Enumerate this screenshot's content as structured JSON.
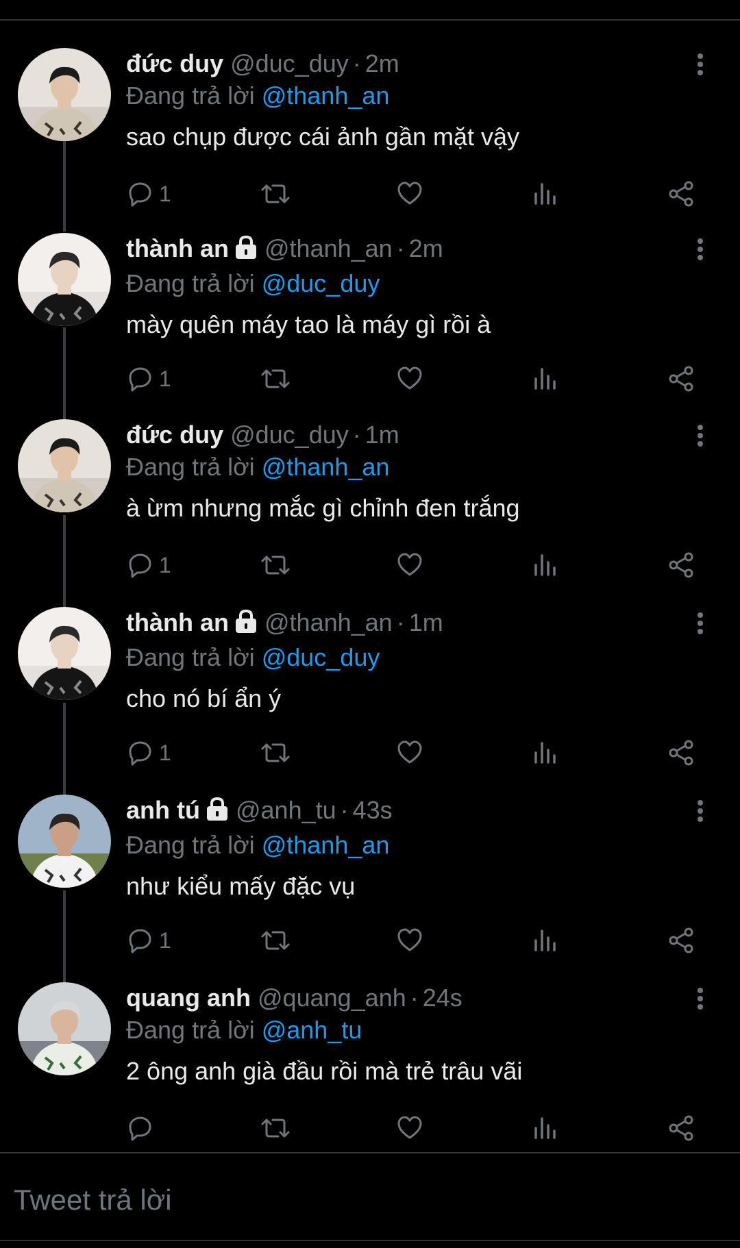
{
  "reply_label": "Đang trả lời",
  "tweets": [
    {
      "name": "đức duy",
      "locked": false,
      "handle": "@duc_duy",
      "time": "2m",
      "reply_to": "@thanh_an",
      "text": "sao chụp được cái ảnh gần mặt vậy",
      "replies": "1",
      "avatar": "avatar-duc-duy"
    },
    {
      "name": "thành an",
      "locked": true,
      "handle": "@thanh_an",
      "time": "2m",
      "reply_to": "@duc_duy",
      "text": "mày quên máy tao là máy gì rồi à",
      "replies": "1",
      "avatar": "avatar-thanh-an"
    },
    {
      "name": "đức duy",
      "locked": false,
      "handle": "@duc_duy",
      "time": "1m",
      "reply_to": "@thanh_an",
      "text": "à ừm nhưng mắc gì chỉnh đen trắng",
      "replies": "1",
      "avatar": "avatar-duc-duy"
    },
    {
      "name": "thành an",
      "locked": true,
      "handle": "@thanh_an",
      "time": "1m",
      "reply_to": "@duc_duy",
      "text": "cho nó bí ẩn ý",
      "replies": "1",
      "avatar": "avatar-thanh-an"
    },
    {
      "name": "anh tú",
      "locked": true,
      "handle": "@anh_tu",
      "time": "43s",
      "reply_to": "@thanh_an",
      "text": "như kiểu mấy đặc vụ",
      "replies": "1",
      "avatar": "avatar-anh-tu"
    },
    {
      "name": "quang anh",
      "locked": false,
      "handle": "@quang_anh",
      "time": "24s",
      "reply_to": "@anh_tu",
      "text": "2 ông anh già đầu rồi mà trẻ trâu vãi",
      "replies": "",
      "avatar": "avatar-quang-anh"
    }
  ],
  "compose": {
    "placeholder": "Tweet trả lời"
  },
  "colors": {
    "background": "#000000",
    "text": "#e7e9ea",
    "muted": "#71767b",
    "link": "#1d9bf0",
    "divider": "#2f3336"
  },
  "icons": {
    "reply": "reply-icon",
    "retweet": "retweet-icon",
    "like": "like-icon",
    "views": "views-icon",
    "share": "share-icon",
    "more": "more-icon",
    "lock": "lock-icon"
  }
}
